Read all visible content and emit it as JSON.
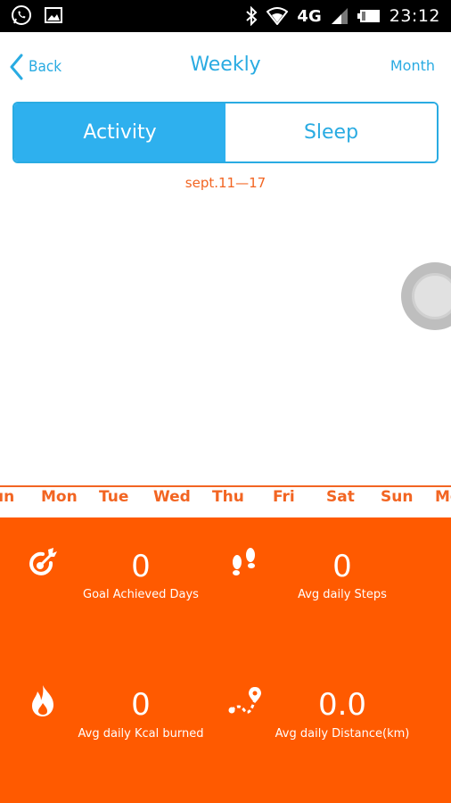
{
  "status_bar": {
    "time": "23:12",
    "network": "4G",
    "icons": [
      "whatsapp-icon",
      "image-icon",
      "bluetooth-icon",
      "wifi-icon",
      "signal-icon",
      "battery-icon"
    ]
  },
  "header": {
    "back_label": "Back",
    "title": "Weekly",
    "month_label": "Month"
  },
  "tabs": [
    {
      "label": "Activity",
      "active": true
    },
    {
      "label": "Sleep",
      "active": false
    }
  ],
  "date_range": "sept.11—17",
  "days": [
    "un",
    "Mon",
    "Tue",
    "Wed",
    "Thu",
    "Fri",
    "Sat",
    "Sun",
    "Mo"
  ],
  "stats": [
    {
      "value": "0",
      "label": "Goal Achieved Days",
      "icon": "goal-target-icon"
    },
    {
      "value": "0",
      "label": "Avg daily Steps",
      "icon": "footprints-icon"
    },
    {
      "value": "0",
      "label": "Avg daily Kcal burned",
      "icon": "flame-icon"
    },
    {
      "value": "0.0",
      "label": "Avg daily Distance(km)",
      "icon": "route-icon"
    }
  ],
  "colors": {
    "accent_blue": "#29abe2",
    "orange": "#ff5a00",
    "text_orange": "#f26522"
  }
}
